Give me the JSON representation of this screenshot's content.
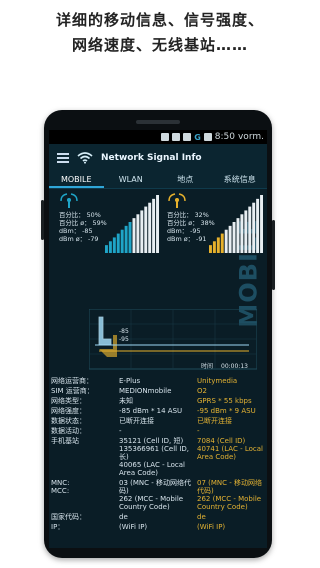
{
  "promo": {
    "line1": "详细的移动信息、信号强度、",
    "line2": "网络速度、无线基站……"
  },
  "statusbar": {
    "generation": "G",
    "time": "8:50",
    "suffix": "vorm."
  },
  "app": {
    "title": "Network Signal Info"
  },
  "tabs": [
    "MOBILE",
    "WLAN",
    "地点",
    "系统信息"
  ],
  "watermark": "MOBILE",
  "signal": {
    "left": {
      "lines": [
        "百分比：   50%",
        "百分比 ø： 59%",
        "dBm：  -85",
        "dBm ø：  -79"
      ],
      "bars_level": 0.5,
      "color": "#1fa5c8"
    },
    "right": {
      "lines": [
        "百分比：   32%",
        "百分比 ø：  38%",
        "dBm：  -95",
        "dBm ø：  -91"
      ],
      "bars_level": 0.32,
      "color": "#e7b12c"
    }
  },
  "history": {
    "label_85": "-85",
    "label_95": "-95",
    "axis_label": "时间",
    "time_label": "00:00:13"
  },
  "info_rows": [
    {
      "label": "网络运营商：",
      "v1": "E-Plus",
      "v2": "Unitymedia"
    },
    {
      "label": "SIM 运营商：",
      "v1": "MEDIONmobile",
      "v2": "O2"
    },
    {
      "label": "网络类型：",
      "v1": "未知",
      "v2": "GPRS * 55 kbps"
    },
    {
      "label": "网络强度：",
      "v1": "-85 dBm * 14 ASU",
      "v2": "-95 dBm * 9 ASU"
    },
    {
      "label": "数据状态：",
      "v1": "已断开连接",
      "v2": "已断开连接"
    },
    {
      "label": "数据活动：",
      "v1": "-",
      "v2": "-"
    },
    {
      "label": "手机基站",
      "v1": "35121 (Cell ID, 短)\n135366961 (Cell ID, 长)\n40065 (LAC - Local Area Code)",
      "v2": "7084 (Cell ID)\n40741 (LAC - Local Area Code)"
    },
    {
      "label": "MNC:\nMCC:",
      "v1": "03 (MNC - 移动网络代码)\n262 (MCC - Mobile Country Code)",
      "v2": "07 (MNC - 移动网络代码)\n262 (MCC - Mobile Country Code)"
    },
    {
      "label": "国家代码：",
      "v1": "de",
      "v2": "de"
    },
    {
      "label": "IP：",
      "v1": "(WiFi IP)",
      "v2": "(WiFi IP)"
    }
  ]
}
